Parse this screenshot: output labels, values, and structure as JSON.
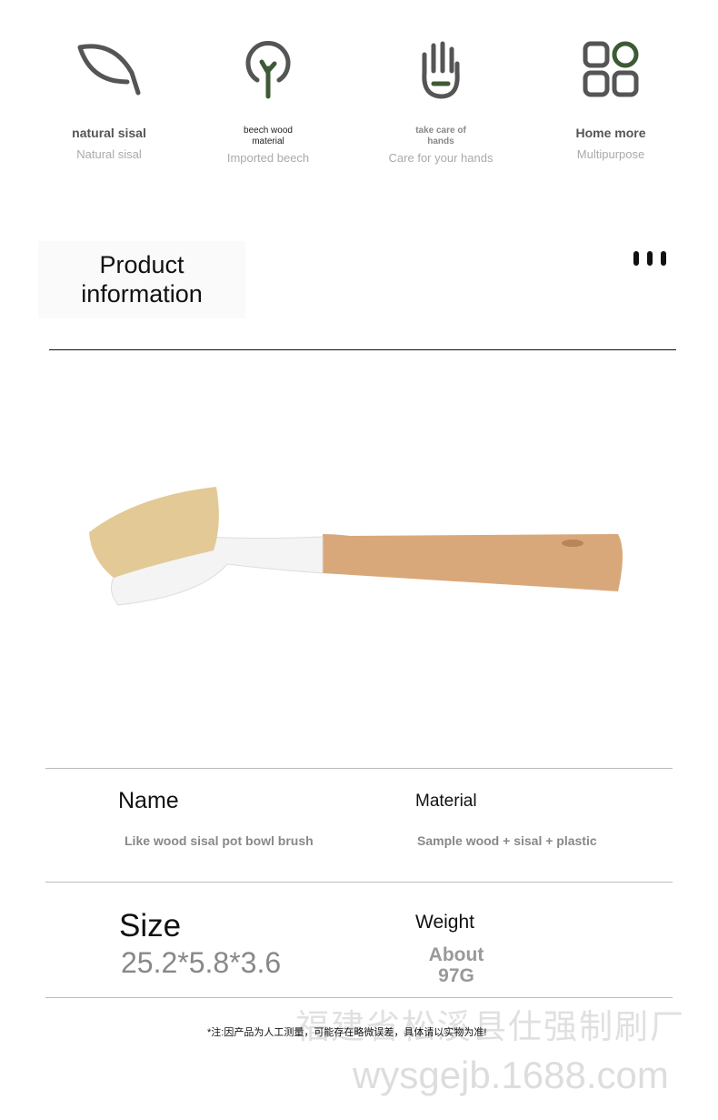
{
  "features": [
    {
      "icon": "leaf-icon",
      "title": "natural sisal",
      "subtitle": "Natural sisal"
    },
    {
      "icon": "tree-icon",
      "title": "beech wood material",
      "subtitle": "Imported beech"
    },
    {
      "icon": "hand-icon",
      "title": "take care of hands",
      "subtitle": "Care for your hands"
    },
    {
      "icon": "grid-icon",
      "title": "Home more",
      "subtitle": "Multipurpose"
    }
  ],
  "section_title": "Product information",
  "specs": {
    "name_label": "Name",
    "name_value": "Like wood sisal pot bowl brush",
    "material_label": "Material",
    "material_value": "Sample wood + sisal + plastic",
    "size_label": "Size",
    "size_value": "25.2*5.8*3.6",
    "weight_label": "Weight",
    "weight_value": "About 97G"
  },
  "note": "*注:因产品为人工测量，可能存在略微误差，具体请以实物为准!",
  "watermark": {
    "company": "福建省松溪县仕强制刷厂",
    "site": "wysgejb.1688.com"
  },
  "colors": {
    "icon": "#555555",
    "accent": "#3d5a35"
  }
}
